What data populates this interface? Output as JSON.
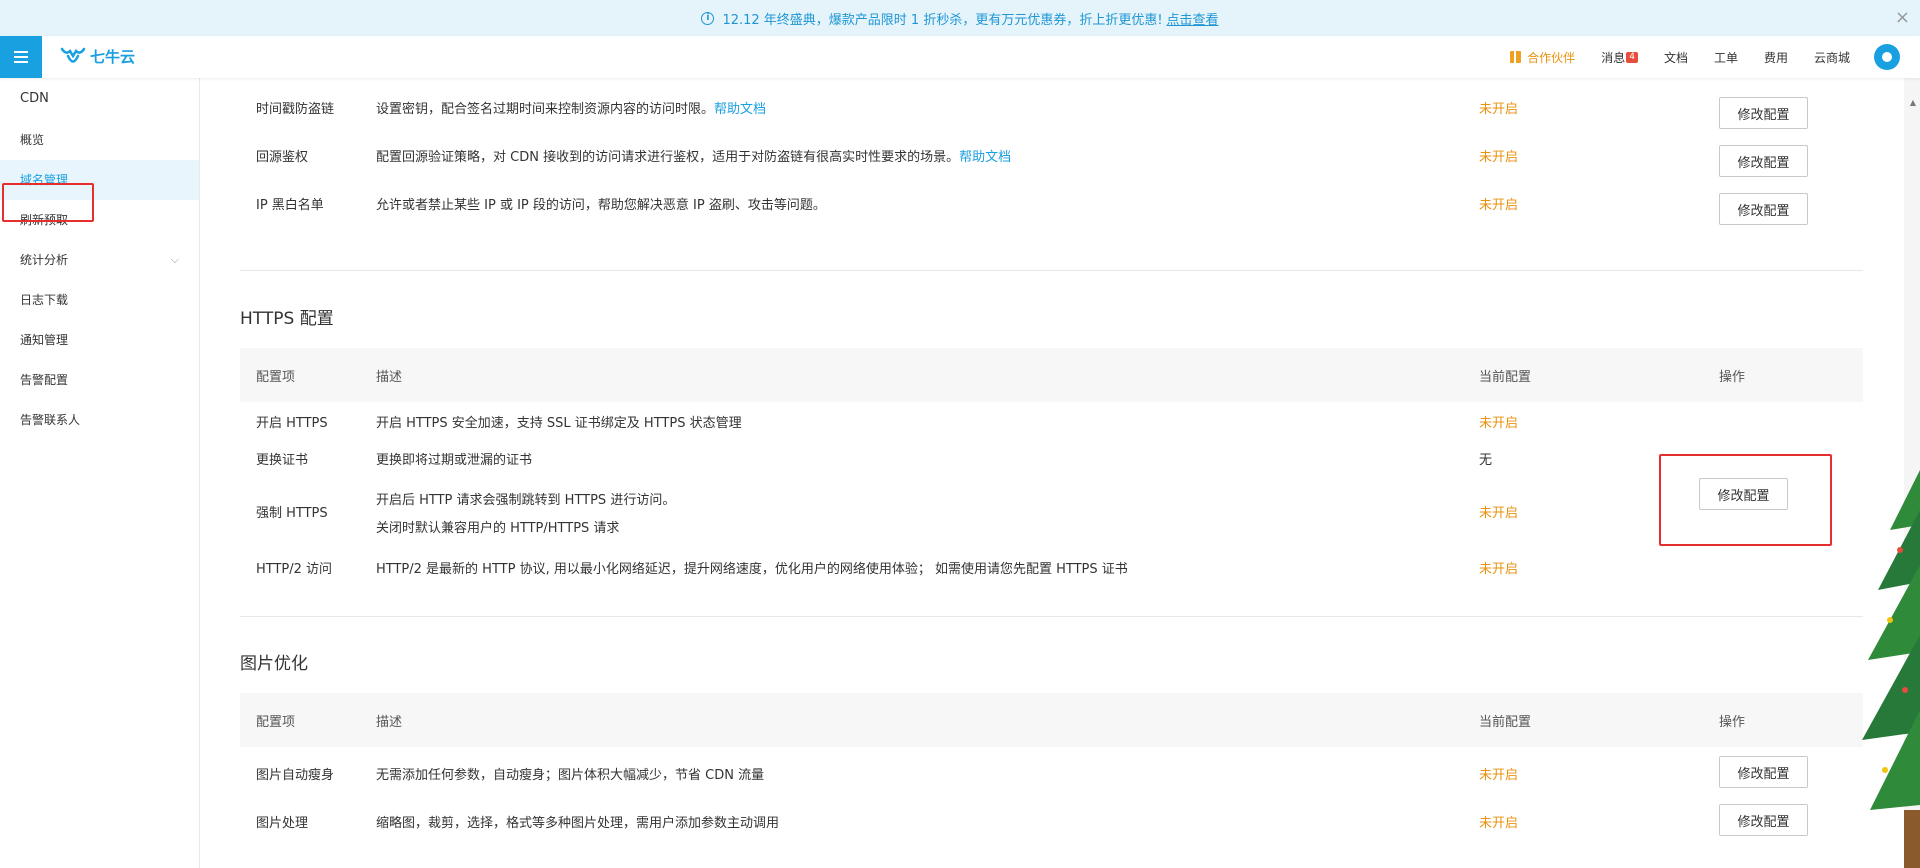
{
  "announcement": {
    "text": "12.12 年终盛典，爆款产品限时 1 折秒杀，更有万元优惠券，折上折更优惠!",
    "link": "点击查看"
  },
  "header": {
    "logo_text": "七牛云",
    "nav": {
      "partner": "合作伙伴",
      "messages": "消息",
      "messages_badge": "4",
      "docs": "文档",
      "tickets": "工单",
      "billing": "费用",
      "marketplace": "云商城"
    }
  },
  "sidebar": {
    "title": "CDN",
    "items": [
      {
        "label": "概览"
      },
      {
        "label": "域名管理"
      },
      {
        "label": "刷新预取"
      },
      {
        "label": "统计分析"
      },
      {
        "label": "日志下载"
      },
      {
        "label": "通知管理"
      },
      {
        "label": "告警配置"
      },
      {
        "label": "告警联系人"
      }
    ]
  },
  "access_control_rows": [
    {
      "name": "时间戳防盗链",
      "desc": "设置密钥，配合签名过期时间来控制资源内容的访问时限。",
      "link": "帮助文档",
      "status": "未开启",
      "action": "修改配置"
    },
    {
      "name": "回源鉴权",
      "desc": "配置回源验证策略，对 CDN 接收到的访问请求进行鉴权，适用于对防盗链有很高实时性要求的场景。",
      "link": "帮助文档",
      "status": "未开启",
      "action": "修改配置"
    },
    {
      "name": "IP 黑白名单",
      "desc": "允许或者禁止某些 IP 或 IP 段的访问，帮助您解决恶意 IP 盗刷、攻击等问题。",
      "status": "未开启",
      "action": "修改配置"
    }
  ],
  "https": {
    "title": "HTTPS 配置",
    "headers": {
      "item": "配置项",
      "desc": "描述",
      "current": "当前配置",
      "op": "操作"
    },
    "rows": [
      {
        "name": "开启 HTTPS",
        "desc": "开启 HTTPS 安全加速，支持 SSL 证书绑定及 HTTPS 状态管理",
        "status": "未开启"
      },
      {
        "name": "更换证书",
        "desc": "更换即将过期或泄漏的证书",
        "status": "无"
      },
      {
        "name": "强制 HTTPS",
        "desc": "开启后 HTTP 请求会强制跳转到 HTTPS 进行访问。",
        "desc2": "关闭时默认兼容用户的 HTTP/HTTPS 请求",
        "status": "未开启"
      },
      {
        "name": "HTTP/2 访问",
        "desc": "HTTP/2 是最新的 HTTP 协议, 用以最小化网络延迟，提升网络速度，优化用户的网络使用体验； 如需使用请您先配置 HTTPS 证书",
        "status": "未开启"
      }
    ],
    "action": "修改配置"
  },
  "image_opt": {
    "title": "图片优化",
    "headers": {
      "item": "配置项",
      "desc": "描述",
      "current": "当前配置",
      "op": "操作"
    },
    "rows": [
      {
        "name": "图片自动瘦身",
        "desc": "无需添加任何参数，自动瘦身；图片体积大幅减少，节省 CDN 流量",
        "status": "未开启",
        "action": "修改配置"
      },
      {
        "name": "图片处理",
        "desc": "缩略图，裁剪，选择，格式等多种图片处理，需用户添加参数主动调用",
        "status": "未开启",
        "action": "修改配置"
      }
    ]
  },
  "colors": {
    "brand": "#19a0e0",
    "status_off": "#e8920f",
    "highlight": "#e62e2e"
  }
}
